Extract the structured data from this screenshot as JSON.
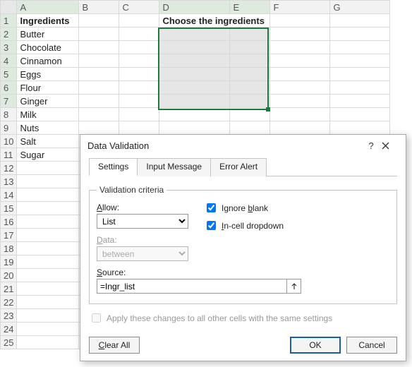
{
  "grid": {
    "columns": [
      "A",
      "B",
      "C",
      "D",
      "E",
      "F",
      "G"
    ],
    "rows": 25,
    "headerA": "Ingredients",
    "headerDE": "Choose the ingredients",
    "colA_values": [
      "Butter",
      "Chocolate",
      "Cinnamon",
      "Eggs",
      "Flour",
      "Ginger",
      "Milk",
      "Nuts",
      "Salt",
      "Sugar"
    ]
  },
  "dialog": {
    "title": "Data Validation",
    "tabs": {
      "settings": "Settings",
      "input_msg": "Input Message",
      "error": "Error Alert"
    },
    "legend": "Validation criteria",
    "allow_label": "Allow:",
    "allow_value": "List",
    "data_label": "Data:",
    "data_value": "between",
    "source_label": "Source:",
    "source_value": "=Ingr_list",
    "ignore_blank": "Ignore blank",
    "incell_dd": "In-cell dropdown",
    "apply_msg": "Apply these changes to all other cells with the same settings",
    "clear": "Clear All",
    "ok": "OK",
    "cancel": "Cancel"
  }
}
